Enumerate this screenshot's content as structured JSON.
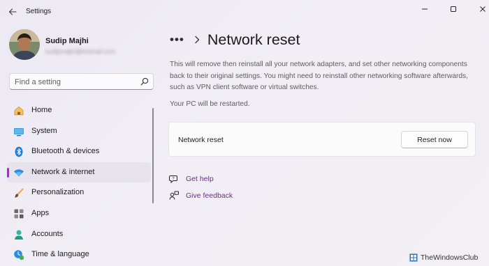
{
  "window": {
    "title": "Settings"
  },
  "profile": {
    "name": "Sudip Majhi",
    "email": "sudipmajhi@hotmail.com"
  },
  "search": {
    "placeholder": "Find a setting"
  },
  "nav": {
    "items": [
      {
        "label": "Home",
        "icon": "home-icon"
      },
      {
        "label": "System",
        "icon": "system-icon"
      },
      {
        "label": "Bluetooth & devices",
        "icon": "bluetooth-icon"
      },
      {
        "label": "Network & internet",
        "icon": "wifi-icon",
        "active": true
      },
      {
        "label": "Personalization",
        "icon": "brush-icon"
      },
      {
        "label": "Apps",
        "icon": "apps-icon"
      },
      {
        "label": "Accounts",
        "icon": "accounts-icon"
      },
      {
        "label": "Time & language",
        "icon": "time-language-icon"
      }
    ]
  },
  "breadcrumb": {
    "more": "•••",
    "current": "Network reset"
  },
  "content": {
    "description": "This will remove then reinstall all your network adapters, and set other networking components back to their original settings. You might need to reinstall other networking software afterwards, such as VPN client software or virtual switches.",
    "restart_note": "Your PC will be restarted.",
    "card_label": "Network reset",
    "reset_button": "Reset now",
    "get_help": "Get help",
    "give_feedback": "Give feedback"
  },
  "watermark": {
    "text": "TheWindowsClub"
  },
  "colors": {
    "accent": "#8e3fa9",
    "link": "#6b2e86",
    "background": "#efecf4",
    "card": "#fbfbfc"
  }
}
